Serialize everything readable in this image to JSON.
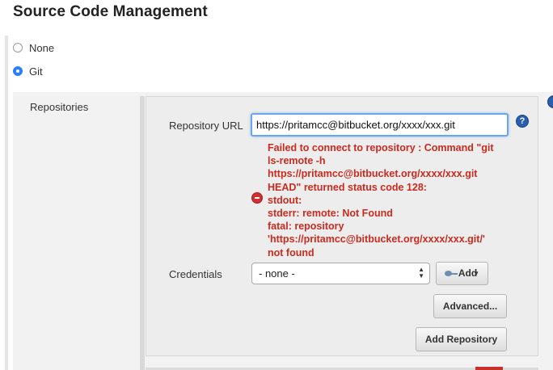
{
  "section": {
    "title": "Source Code Management"
  },
  "scm_options": [
    {
      "label": "None",
      "checked": false
    },
    {
      "label": "Git",
      "checked": true
    }
  ],
  "repositories": {
    "label": "Repositories",
    "url_label": "Repository URL",
    "url_value": "https://pritamcc@bitbucket.org/xxxx/xxx.git",
    "error_lines": [
      "Failed to connect to repository : Command \"git",
      "ls-remote -h",
      "https://pritamcc@bitbucket.org/xxxx/xxx.git",
      "HEAD\" returned status code 128:",
      "stdout:",
      "stderr: remote: Not Found",
      "fatal: repository",
      "'https://pritamcc@bitbucket.org/xxxx/xxx.git/'",
      "not found"
    ],
    "credentials_label": "Credentials",
    "credentials_value": "- none -",
    "add_label": "Add",
    "advanced_label": "Advanced...",
    "add_repository_label": "Add Repository"
  },
  "icons": {
    "help": "help-icon",
    "error": "error-icon",
    "key": "key-icon"
  },
  "colors": {
    "error": "#cc2a1e",
    "focus": "#6aa6ee",
    "help": "#2a5fb0"
  }
}
